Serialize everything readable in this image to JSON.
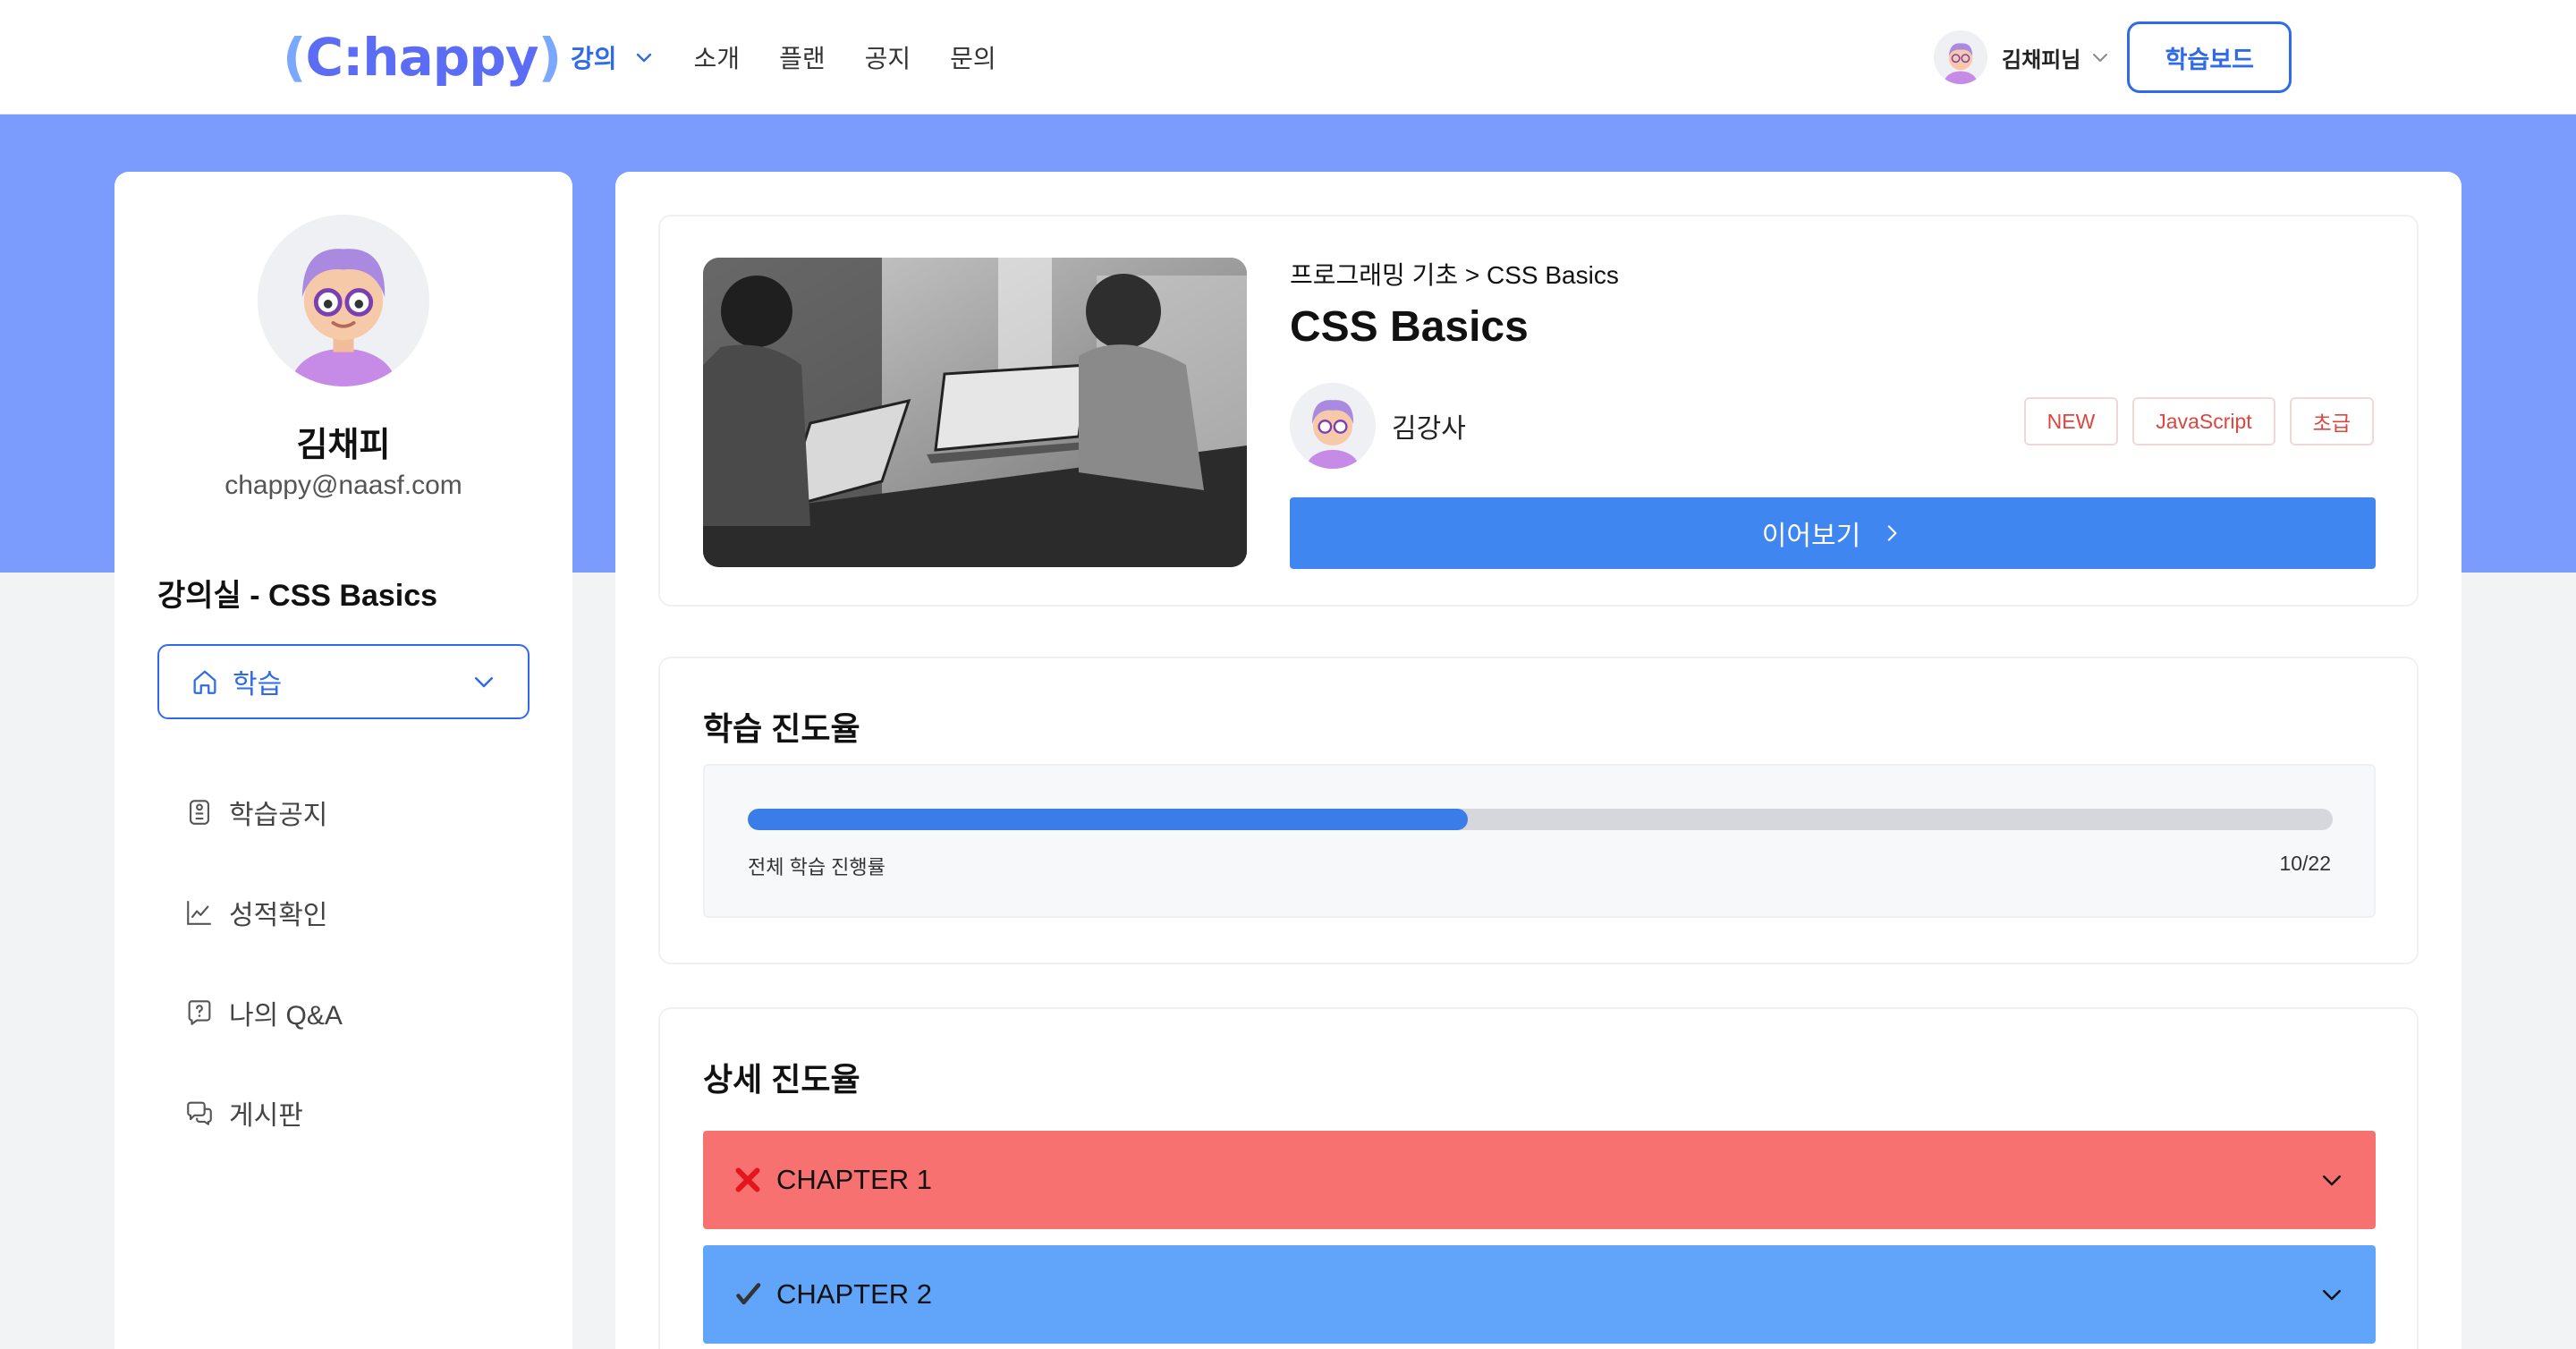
{
  "header": {
    "logo": {
      "open": "(",
      "text": "C:happy",
      "close": ")"
    },
    "nav": [
      {
        "label": "강의",
        "active": true
      },
      {
        "label": "소개"
      },
      {
        "label": "플랜"
      },
      {
        "label": "공지"
      },
      {
        "label": "문의"
      }
    ],
    "user_name": "김채피님",
    "board_button": "학습보드"
  },
  "sidebar": {
    "name": "김채피",
    "email": "chappy@naasf.com",
    "class_title": "강의실 - CSS Basics",
    "select_label": "학습",
    "menu": [
      {
        "label": "학습공지",
        "icon": "notice-icon"
      },
      {
        "label": "성적확인",
        "icon": "chart-icon"
      },
      {
        "label": "나의 Q&A",
        "icon": "question-icon"
      },
      {
        "label": "게시판",
        "icon": "chat-icon"
      }
    ]
  },
  "course": {
    "breadcrumb": "프로그래밍 기초 > CSS Basics",
    "title": "CSS Basics",
    "instructor": "김강사",
    "tags": [
      "NEW",
      "JavaScript",
      "초급"
    ],
    "continue_label": "이어보기"
  },
  "progress": {
    "title": "학습 진도율",
    "label": "전체 학습 진행률",
    "count": "10/22",
    "completed": 10,
    "total": 22
  },
  "detail": {
    "title": "상세 진도율",
    "chapters": [
      {
        "label": "CHAPTER 1",
        "status": "incomplete",
        "color": "#f87171"
      },
      {
        "label": "CHAPTER 2",
        "status": "complete",
        "color": "#60a5fa"
      }
    ]
  },
  "colors": {
    "accent": "#2f6be8",
    "band": "#7b9cfd",
    "button": "#3f86f0",
    "tag_text": "#e0443e"
  }
}
